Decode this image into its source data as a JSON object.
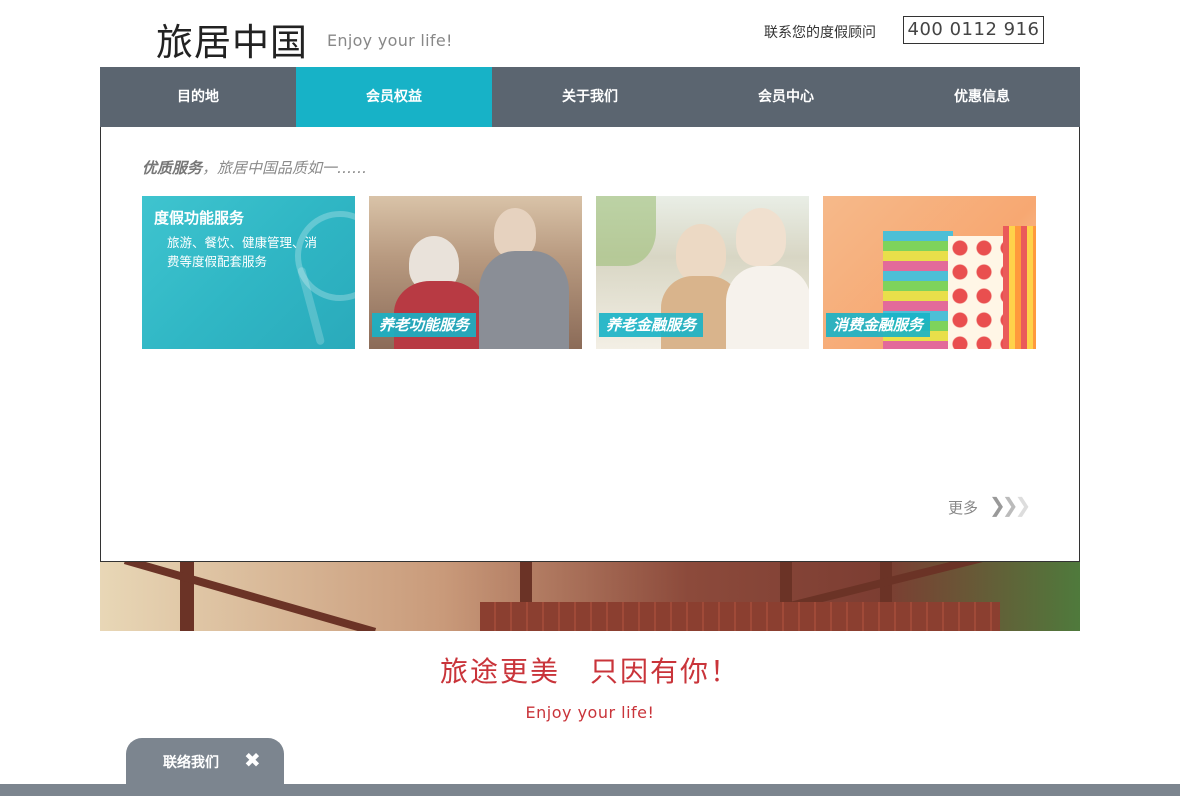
{
  "header": {
    "logo_cn": "旅居中国",
    "logo_en": "Enjoy your life!",
    "contact_label": "联系您的度假顾问",
    "phone": "400 0112 916"
  },
  "nav": {
    "items": [
      {
        "label": "目的地"
      },
      {
        "label": "会员权益"
      },
      {
        "label": "关于我们"
      },
      {
        "label": "会员中心"
      },
      {
        "label": "优惠信息"
      }
    ],
    "active_index": 1
  },
  "content": {
    "intro_bold": "优质服务",
    "intro_rest": "，旅居中国品质如一……",
    "cards": [
      {
        "title": "度假功能服务",
        "desc": "旅游、餐饮、健康管理、消费等度假配套服务"
      },
      {
        "tag": "养老功能服务"
      },
      {
        "tag": "养老金融服务"
      },
      {
        "tag": "消费金融服务"
      }
    ],
    "more_label": "更多",
    "more_icon": "chevron-triple-right-icon"
  },
  "slogan": {
    "cn": "旅途更美　只因有你！",
    "en": "Enjoy your life!"
  },
  "footer": {
    "contact_tab_label": "联络我们",
    "close_icon": "close-icon"
  },
  "colors": {
    "accent": "#17b2c7",
    "nav_bg": "#5b6570",
    "slogan": "#c9343a",
    "footer": "#7c858f"
  }
}
